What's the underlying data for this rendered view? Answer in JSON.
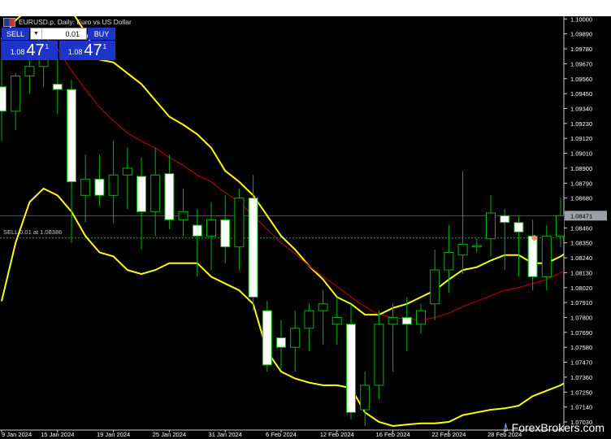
{
  "header": {
    "symbol_title": "EURUSD.p, Daily:  Euro vs US Dollar"
  },
  "trade_panel": {
    "sell_label": "SELL",
    "buy_label": "BUY",
    "lot_value": "0.01",
    "sell_price_prefix": "1.08",
    "sell_price_big": "47",
    "sell_price_sup": "1",
    "buy_price_prefix": "1.08",
    "buy_price_big": "47",
    "buy_price_sup": "1"
  },
  "order_line": {
    "label": "SELL 0.01 at 1.08386",
    "price": 1.08386
  },
  "current_price_label": "1.08471",
  "watermark": {
    "text": "ForexBrokers.com"
  },
  "colors": {
    "background": "#000000",
    "bull_candle": "#ffffff",
    "bear_candle": "#ffffff",
    "wick": "#00b400",
    "bollinger": "#ffff00",
    "middle_band": "#b00000",
    "axis_text": "#ffffff",
    "price_tag_bg": "#9aa0a6",
    "order_line": "#2f8f2f",
    "order_marker": "#ff8c69"
  },
  "chart_data": {
    "type": "candlestick",
    "y_ticks": [
      "1.10000",
      "1.09890",
      "1.09780",
      "1.09670",
      "1.09560",
      "1.09450",
      "1.09340",
      "1.09230",
      "1.09120",
      "1.09010",
      "1.08900",
      "1.08790",
      "1.08680",
      "1.08571",
      "1.08460",
      "1.08350",
      "1.08240",
      "1.08130",
      "1.08020",
      "1.07910",
      "1.07800",
      "1.07690",
      "1.07580",
      "1.07470",
      "1.07360",
      "1.07250",
      "1.07140",
      "1.07030"
    ],
    "ylim": [
      1.0697,
      1.1002
    ],
    "x_ticks": [
      {
        "label": "9 Jan 2024",
        "i": 0
      },
      {
        "label": "15 Jan 2024",
        "i": 4
      },
      {
        "label": "19 Jan 2024",
        "i": 8
      },
      {
        "label": "25 Jan 2024",
        "i": 12
      },
      {
        "label": "31 Jan 2024",
        "i": 16
      },
      {
        "label": "6 Feb 2024",
        "i": 20
      },
      {
        "label": "12 Feb 2024",
        "i": 24
      },
      {
        "label": "16 Feb 2024",
        "i": 28
      },
      {
        "label": "22 Feb 2024",
        "i": 32
      },
      {
        "label": "28 Feb 2024",
        "i": 36
      }
    ],
    "candles": [
      {
        "o": 1.095,
        "h": 1.0985,
        "l": 1.091,
        "c": 1.0932
      },
      {
        "o": 1.0932,
        "h": 1.096,
        "l": 1.0918,
        "c": 1.0958
      },
      {
        "o": 1.0958,
        "h": 1.0975,
        "l": 1.0945,
        "c": 1.0965
      },
      {
        "o": 1.0965,
        "h": 1.099,
        "l": 1.095,
        "c": 1.0985
      },
      {
        "o": 1.0952,
        "h": 1.0978,
        "l": 1.093,
        "c": 1.0948
      },
      {
        "o": 1.0948,
        "h": 1.0955,
        "l": 1.0835,
        "c": 1.088
      },
      {
        "o": 1.087,
        "h": 1.09,
        "l": 1.085,
        "c": 1.0882
      },
      {
        "o": 1.0882,
        "h": 1.09,
        "l": 1.0862,
        "c": 1.087
      },
      {
        "o": 1.087,
        "h": 1.091,
        "l": 1.085,
        "c": 1.0885
      },
      {
        "o": 1.0885,
        "h": 1.0905,
        "l": 1.086,
        "c": 1.089
      },
      {
        "o": 1.0884,
        "h": 1.0898,
        "l": 1.083,
        "c": 1.0858
      },
      {
        "o": 1.0858,
        "h": 1.0905,
        "l": 1.084,
        "c": 1.0885
      },
      {
        "o": 1.0886,
        "h": 1.09,
        "l": 1.0845,
        "c": 1.0852
      },
      {
        "o": 1.0852,
        "h": 1.0875,
        "l": 1.084,
        "c": 1.0858
      },
      {
        "o": 1.0848,
        "h": 1.086,
        "l": 1.081,
        "c": 1.084
      },
      {
        "o": 1.084,
        "h": 1.0865,
        "l": 1.0815,
        "c": 1.0852
      },
      {
        "o": 1.0852,
        "h": 1.087,
        "l": 1.082,
        "c": 1.0832
      },
      {
        "o": 1.0832,
        "h": 1.0875,
        "l": 1.0815,
        "c": 1.0868
      },
      {
        "o": 1.0868,
        "h": 1.0885,
        "l": 1.0785,
        "c": 1.0795
      },
      {
        "o": 1.0785,
        "h": 1.0792,
        "l": 1.074,
        "c": 1.0745
      },
      {
        "o": 1.0765,
        "h": 1.0778,
        "l": 1.0742,
        "c": 1.0758
      },
      {
        "o": 1.0758,
        "h": 1.0785,
        "l": 1.074,
        "c": 1.0772
      },
      {
        "o": 1.0772,
        "h": 1.079,
        "l": 1.0755,
        "c": 1.0785
      },
      {
        "o": 1.0785,
        "h": 1.08,
        "l": 1.076,
        "c": 1.079
      },
      {
        "o": 1.0775,
        "h": 1.0795,
        "l": 1.076,
        "c": 1.078
      },
      {
        "o": 1.0775,
        "h": 1.079,
        "l": 1.0705,
        "c": 1.071
      },
      {
        "o": 1.0712,
        "h": 1.074,
        "l": 1.07,
        "c": 1.073
      },
      {
        "o": 1.073,
        "h": 1.0785,
        "l": 1.072,
        "c": 1.0775
      },
      {
        "o": 1.0775,
        "h": 1.079,
        "l": 1.074,
        "c": 1.078
      },
      {
        "o": 1.078,
        "h": 1.0795,
        "l": 1.0755,
        "c": 1.0775
      },
      {
        "o": 1.0775,
        "h": 1.079,
        "l": 1.0768,
        "c": 1.0785
      },
      {
        "o": 1.079,
        "h": 1.083,
        "l": 1.0778,
        "c": 1.0815
      },
      {
        "o": 1.0815,
        "h": 1.0848,
        "l": 1.0798,
        "c": 1.0828
      },
      {
        "o": 1.0826,
        "h": 1.0888,
        "l": 1.0812,
        "c": 1.0834
      },
      {
        "o": 1.0832,
        "h": 1.0838,
        "l": 1.0828,
        "c": 1.0833
      },
      {
        "o": 1.0838,
        "h": 1.087,
        "l": 1.0825,
        "c": 1.0857
      },
      {
        "o": 1.0855,
        "h": 1.086,
        "l": 1.0815,
        "c": 1.085
      },
      {
        "o": 1.085,
        "h": 1.0855,
        "l": 1.081,
        "c": 1.0843
      },
      {
        "o": 1.084,
        "h": 1.0852,
        "l": 1.08,
        "c": 1.081
      },
      {
        "o": 1.081,
        "h": 1.0848,
        "l": 1.08,
        "c": 1.084
      },
      {
        "o": 1.084,
        "h": 1.0868,
        "l": 1.0832,
        "c": 1.0855
      }
    ],
    "bollinger_upper": [
      1.0985,
      1.0999,
      1.1008,
      1.1015,
      1.1014,
      1.1006,
      1.099,
      1.097,
      1.0968,
      1.096,
      1.0952,
      1.094,
      1.0928,
      1.0922,
      1.0915,
      1.0905,
      1.0888,
      1.088,
      1.087,
      1.0855,
      1.084,
      1.083,
      1.0818,
      1.0808,
      1.0795,
      1.079,
      1.0782,
      1.0782,
      1.0787,
      1.079,
      1.0795,
      1.08,
      1.0808,
      1.0815,
      1.0817,
      1.0822,
      1.0826,
      1.0826,
      1.082,
      1.082,
      1.0825,
      1.0832
    ],
    "bollinger_middle": [
      null,
      null,
      null,
      null,
      1.0978,
      1.0962,
      1.0948,
      1.0935,
      1.0925,
      1.0916,
      1.091,
      1.0905,
      1.0898,
      1.0892,
      1.0885,
      1.088,
      1.0872,
      1.0865,
      1.0855,
      1.0845,
      1.0835,
      1.0827,
      1.0818,
      1.081,
      1.0803,
      1.0795,
      1.0788,
      1.0782,
      1.078,
      1.0779,
      1.0778,
      1.078,
      1.0783,
      1.0788,
      1.0792,
      1.0796,
      1.08,
      1.0802,
      1.0805,
      1.0808,
      1.0813,
      1.0818
    ],
    "bollinger_lower": [
      1.0792,
      1.0835,
      1.0865,
      1.0875,
      1.087,
      1.0858,
      1.084,
      1.0828,
      1.0825,
      1.0815,
      1.0812,
      1.0815,
      1.082,
      1.082,
      1.082,
      1.081,
      1.0805,
      1.08,
      1.079,
      1.0755,
      1.074,
      1.0735,
      1.0732,
      1.073,
      1.073,
      1.0728,
      1.071,
      1.0703,
      1.07,
      1.0701,
      1.0702,
      1.0702,
      1.0703,
      1.0708,
      1.071,
      1.0712,
      1.0713,
      1.0715,
      1.0722,
      1.0726,
      1.073,
      1.0736
    ]
  }
}
